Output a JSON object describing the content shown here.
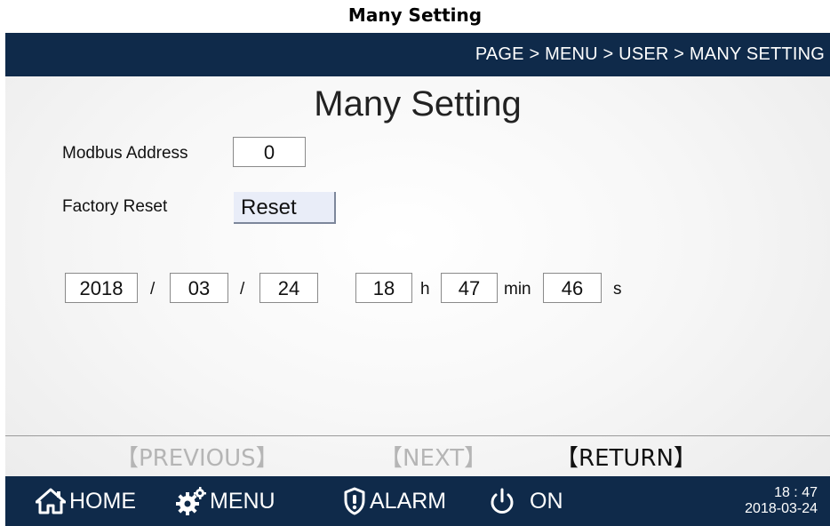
{
  "document_title": "Many Setting",
  "breadcrumb": "PAGE > MENU > USER > MANY SETTING",
  "page_title": "Many Setting",
  "modbus": {
    "label": "Modbus Address",
    "value": "0"
  },
  "factory": {
    "label": "Factory Reset",
    "button": "Reset"
  },
  "datetime": {
    "year": "2018",
    "month": "03",
    "day": "24",
    "hour": "18",
    "minute": "47",
    "second": "46",
    "date_sep": "/",
    "h_unit": "h",
    "min_unit": "min",
    "s_unit": "s"
  },
  "nav": {
    "previous": "【PREVIOUS】",
    "next": "【NEXT】",
    "return": "【RETURN】"
  },
  "footer": {
    "home": "HOME",
    "menu": "MENU",
    "alarm": "ALARM",
    "power": "ON",
    "time": "18 : 47",
    "date": "2018-03-24"
  },
  "colors": {
    "bar": "#0f2a4a",
    "dim_text": "#b5b5b5",
    "button": "#e9edf8"
  },
  "icons": [
    "home-icon",
    "gears-icon",
    "alarm-shield-icon",
    "power-icon"
  ]
}
